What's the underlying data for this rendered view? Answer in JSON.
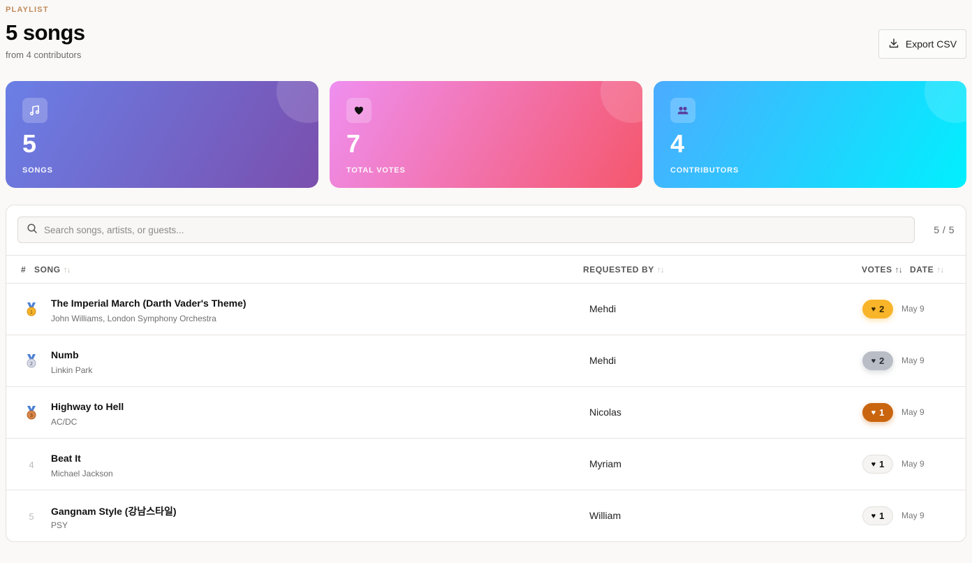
{
  "header": {
    "eyebrow": "PLAYLIST",
    "title": "5 songs",
    "subtitle": "from 4 contributors",
    "export_label": "Export CSV"
  },
  "stats": [
    {
      "value": "5",
      "label": "SONGS",
      "icon": "music-note-icon"
    },
    {
      "value": "7",
      "label": "TOTAL VOTES",
      "icon": "heart-icon"
    },
    {
      "value": "4",
      "label": "CONTRIBUTORS",
      "icon": "users-icon"
    }
  ],
  "search": {
    "placeholder": "Search songs, artists, or guests...",
    "count": "5 / 5"
  },
  "table": {
    "columns": {
      "rank": "#",
      "song": "SONG",
      "requested_by": "REQUESTED BY",
      "votes": "VOTES",
      "date": "DATE"
    },
    "rows": [
      {
        "rank": "1",
        "medal": "gold",
        "title": "The Imperial March (Darth Vader's Theme)",
        "artist": "John Williams, London Symphony Orchestra",
        "requested_by": "Mehdi",
        "votes": "2",
        "heart": "♥",
        "date": "May 9"
      },
      {
        "rank": "2",
        "medal": "silver",
        "title": "Numb",
        "artist": "Linkin Park",
        "requested_by": "Mehdi",
        "votes": "2",
        "heart": "♥",
        "date": "May 9"
      },
      {
        "rank": "3",
        "medal": "bronze",
        "title": "Highway to Hell",
        "artist": "AC/DC",
        "requested_by": "Nicolas",
        "votes": "1",
        "heart": "♥",
        "date": "May 9"
      },
      {
        "rank": "4",
        "medal": "none",
        "title": "Beat It",
        "artist": "Michael Jackson",
        "requested_by": "Myriam",
        "votes": "1",
        "heart": "♥",
        "date": "May 9"
      },
      {
        "rank": "5",
        "medal": "none",
        "title": "Gangnam Style (강남스타일)",
        "artist": "PSY",
        "requested_by": "William",
        "votes": "1",
        "heart": "♥",
        "date": "May 9"
      }
    ]
  },
  "colors": {
    "gold": "#f8b52a",
    "silver": "#b9bec6",
    "bronze": "#c9650f",
    "eyebrow": "#c08a5a"
  }
}
